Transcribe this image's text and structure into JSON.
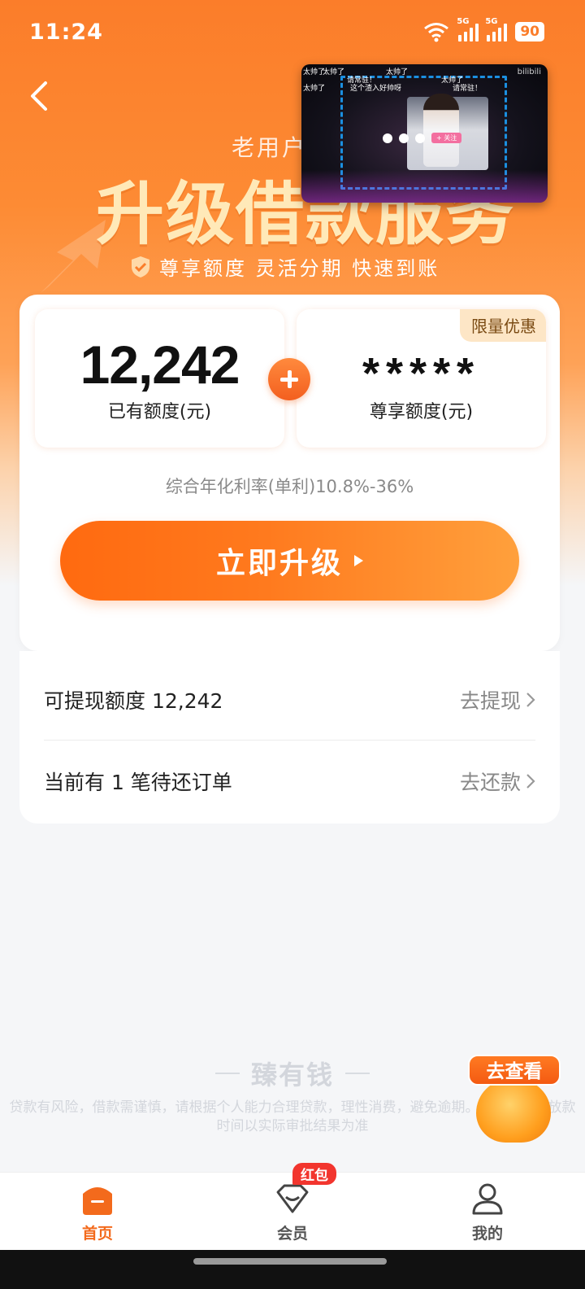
{
  "status_bar": {
    "time": "11:24",
    "wifi_tag": "6",
    "network_1": "5G",
    "network_2": "5G",
    "battery": "90"
  },
  "hero": {
    "subtitle": "老用户",
    "title": "升级借款服务",
    "features": "尊享额度 灵活分期 快速到账"
  },
  "pip_video": {
    "brand": "bilibili",
    "follow_label": "+ 关注",
    "danmu": [
      "太帅了",
      "太帅了",
      "太帅了",
      "请常驻！",
      "太帅了",
      "这个渣入好帅呀",
      "请常驻！",
      "太帅了"
    ]
  },
  "quota": {
    "existing_value": "12,242",
    "existing_label": "已有额度(元)",
    "vip_value": "*****",
    "vip_label": "尊享额度(元)",
    "limited_tag": "限量优惠"
  },
  "rate_text": "综合年化利率(单利)10.8%-36%",
  "upgrade_button": "立即升级",
  "rows": [
    {
      "left": "可提现额度 12,242",
      "right": "去提现"
    },
    {
      "left": "当前有 1 笔待还订单",
      "right": "去还款"
    }
  ],
  "footer": {
    "brand": "臻有钱",
    "disclaimer": "贷款有风险，借款需谨慎，请根据个人能力合理贷款，理性消费，避免逾期。贷款额度、放款时间以实际审批结果为准"
  },
  "float_badge": {
    "label": "去查看"
  },
  "tabbar": {
    "items": [
      {
        "label": "首页",
        "icon": "home-icon",
        "active": true
      },
      {
        "label": "会员",
        "icon": "member-icon",
        "active": false
      },
      {
        "label": "我的",
        "icon": "profile-icon",
        "active": false
      }
    ],
    "member_badge": "红包"
  },
  "colors": {
    "accent": "#f36a1c",
    "hero_start": "#fb7d2a",
    "badge_red": "#f2352e",
    "tag_bg": "#fde6c6"
  }
}
